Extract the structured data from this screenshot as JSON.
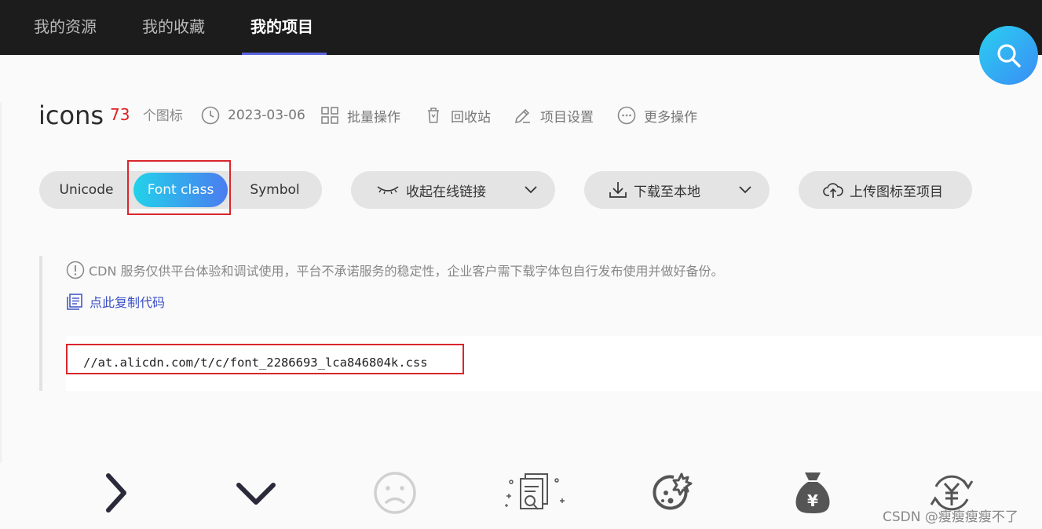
{
  "nav": {
    "tabs": [
      {
        "label": "我的资源"
      },
      {
        "label": "我的收藏"
      },
      {
        "label": "我的项目"
      }
    ]
  },
  "project": {
    "name": "icons",
    "count": "73",
    "count_label": "个图标",
    "date": "2023-03-06",
    "actions": {
      "batch": "批量操作",
      "recycle": "回收站",
      "settings": "项目设置",
      "more": "更多操作"
    }
  },
  "formats": {
    "unicode": "Unicode",
    "font_class": "Font class",
    "symbol": "Symbol",
    "selected": "Font class"
  },
  "buttons": {
    "collapse_link": "收起在线链接",
    "download": "下载至本地",
    "upload": "上传图标至项目"
  },
  "cdn": {
    "notice": "CDN 服务仅供平台体验和调试使用，平台不承诺服务的稳定性，企业客户需下载字体包自行发布使用并做好备份。",
    "copy_label": "点此复制代码",
    "url": "//at.alicdn.com/t/c/font_2286693_lca846804k.css"
  },
  "icons": [
    "chevron-right-icon",
    "chevron-down-icon",
    "sad-face-icon",
    "document-search-icon",
    "cookie-icon",
    "money-bag-icon",
    "yuan-exchange-icon"
  ],
  "watermark": "CSDN @瘦瘦瘦瘦不了",
  "colors": {
    "accent": "#5c63e0",
    "count": "#e02020",
    "link": "#3a4ec5",
    "highlight_box": "#d9262c"
  }
}
